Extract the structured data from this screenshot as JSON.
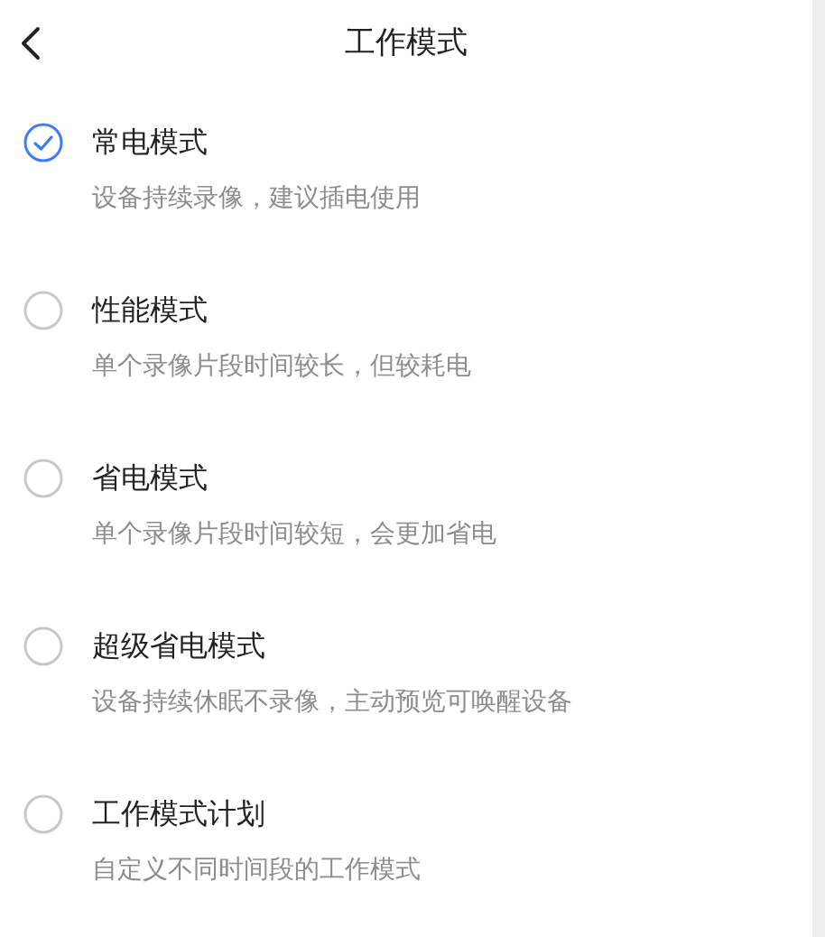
{
  "header": {
    "title": "工作模式"
  },
  "modes": [
    {
      "title": "常电模式",
      "description": "设备持续录像，建议插电使用",
      "selected": true
    },
    {
      "title": "性能模式",
      "description": "单个录像片段时间较长，但较耗电",
      "selected": false
    },
    {
      "title": "省电模式",
      "description": "单个录像片段时间较短，会更加省电",
      "selected": false
    },
    {
      "title": "超级省电模式",
      "description": "设备持续休眠不录像，主动预览可唤醒设备",
      "selected": false
    },
    {
      "title": "工作模式计划",
      "description": "自定义不同时间段的工作模式",
      "selected": false
    }
  ]
}
